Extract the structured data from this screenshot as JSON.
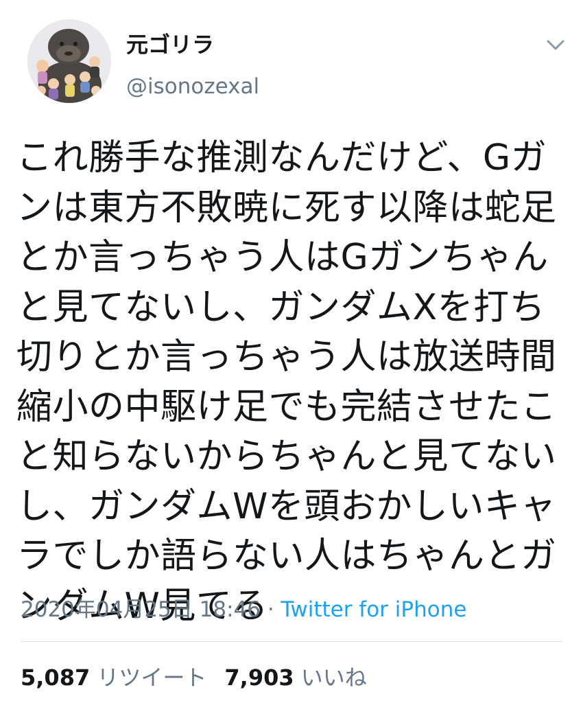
{
  "tweet": {
    "display_name": "元ゴリラ",
    "handle": "@isonozexal",
    "text": "これ勝手な推測なんだけど、Gガ\nンは東方不敗暁に死す以降は蛇足\nとか言っちゃう人はGガンちゃん\nと見てないし、ガンダムXを打ち\n切りとか言っちゃう人は放送時間\n縮小の中駆け足でも完結させたこ\nと知らないからちゃんと見てない\nし、ガンダムWを頭おかしいキャ\nラでしか語らない人はちゃんとガ\nンダムW見てる",
    "timestamp": "2020年04月25日 18:46",
    "separator": " · ",
    "source": "Twitter for iPhone",
    "retweet_count": "5,087",
    "retweet_label": "リツイート",
    "like_count": "7,903",
    "like_label": "いいね"
  },
  "icons": {
    "avatar": "gorilla-avatar",
    "menu": "chevron-down-icon"
  },
  "colors": {
    "text": "#14171a",
    "secondary": "#657786",
    "link": "#1da1f2",
    "divider": "#dcdfe3"
  }
}
